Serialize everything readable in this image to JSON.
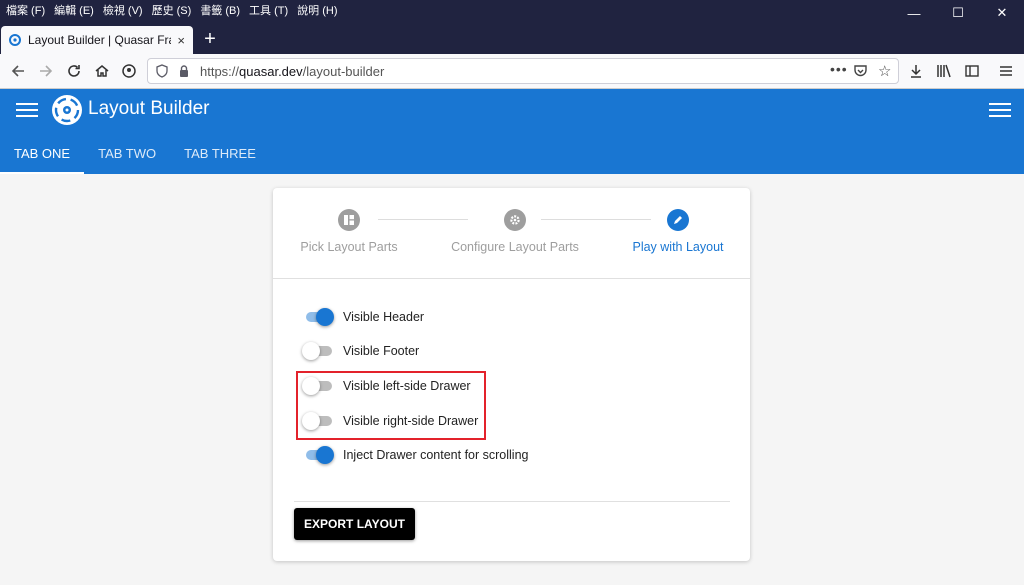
{
  "menu_bar": [
    "檔案 (F)",
    "編輯 (E)",
    "檢視 (V)",
    "歷史 (S)",
    "書籤 (B)",
    "工具 (T)",
    "說明 (H)"
  ],
  "window_controls": {
    "minimize": "—",
    "maximize": "☐",
    "close": "✕"
  },
  "browser_tab": {
    "title": "Layout Builder | Quasar Framework",
    "close": "×"
  },
  "new_tab_label": "+",
  "url": {
    "prefix": "https://",
    "domain": "quasar.dev",
    "path": "/layout-builder",
    "more": "•••"
  },
  "app": {
    "title": "Layout Builder",
    "tabs": [
      "TAB ONE",
      "TAB TWO",
      "TAB THREE"
    ],
    "active_tab": 0,
    "brand_color": "#1976d2"
  },
  "stepper": {
    "steps": [
      {
        "label": "Pick Layout Parts",
        "icon": "view-quilt-icon",
        "active": false
      },
      {
        "label": "Configure Layout Parts",
        "icon": "settings-icon",
        "active": false
      },
      {
        "label": "Play with Layout",
        "icon": "edit-icon",
        "active": true
      }
    ]
  },
  "toggles": [
    {
      "label": "Visible Header",
      "on": true
    },
    {
      "label": "Visible Footer",
      "on": false
    },
    {
      "label": "Visible left-side Drawer",
      "on": false
    },
    {
      "label": "Visible right-side Drawer",
      "on": false
    },
    {
      "label": "Inject Drawer content for scrolling",
      "on": true
    }
  ],
  "export_label": "EXPORT LAYOUT",
  "highlight_color": "#e3222b"
}
